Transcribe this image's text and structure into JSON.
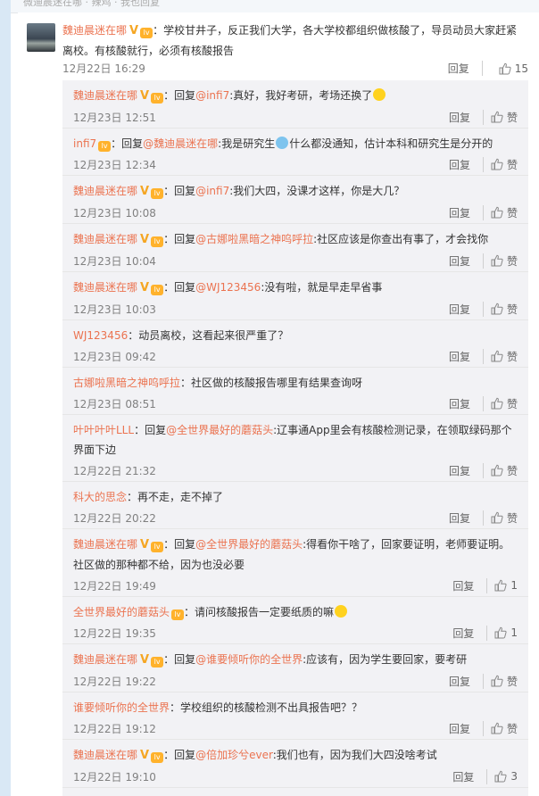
{
  "top": {
    "faint_text": "微迪晨迷在哪 · 辣鸡 · 我也回复"
  },
  "main": {
    "username": "魏迪晨迷在哪",
    "text": "：学校甘井子，反正我们大学，各大学校都组织做核酸了，导员动员大家赶紧离校。有核酸就行，必须有核酸报告",
    "time": "12月22日 16:29",
    "reply_label": "回复",
    "like_count": "15"
  },
  "replies": [
    {
      "user": "魏迪晨迷在哪",
      "v": true,
      "lvl": true,
      "prefix": "：回复",
      "target": "@infi7",
      "text": ":真好，我好考研，考场还换了",
      "emo": "yellow",
      "time": "12月23日 12:51",
      "reply_label": "回复",
      "like": "赞"
    },
    {
      "user": "infi7",
      "v": false,
      "lvl": true,
      "prefix": "：回复",
      "target": "@魏迪晨迷在哪",
      "text": ":我是研究生",
      "emo_mid": "blue",
      "text2": "什么都没通知，估计本科和研究生是分开的",
      "time": "12月23日 12:34",
      "reply_label": "回复",
      "like": "赞"
    },
    {
      "user": "魏迪晨迷在哪",
      "v": true,
      "lvl": true,
      "prefix": "：回复",
      "target": "@infi7",
      "text": ":我们大四，没课才这样，你是大几？",
      "time": "12月23日 10:08",
      "reply_label": "回复",
      "like": "赞"
    },
    {
      "user": "魏迪晨迷在哪",
      "v": true,
      "lvl": true,
      "prefix": "：回复",
      "target": "@古娜啦黑暗之神呜呼拉",
      "text": ":社区应该是你查出有事了，才会找你",
      "time": "12月23日 10:04",
      "reply_label": "回复",
      "like": "赞"
    },
    {
      "user": "魏迪晨迷在哪",
      "v": true,
      "lvl": true,
      "prefix": "：回复",
      "target": "@WJ123456",
      "text": ":没有啦，就是早走早省事",
      "time": "12月23日 10:03",
      "reply_label": "回复",
      "like": "赞"
    },
    {
      "user": "WJ123456",
      "v": false,
      "lvl": false,
      "prefix": "：",
      "target": "",
      "text": "动员离校，这看起来很严重了？",
      "time": "12月23日 09:42",
      "reply_label": "回复",
      "like": "赞"
    },
    {
      "user": "古娜啦黑暗之神呜呼拉",
      "v": false,
      "lvl": false,
      "prefix": "：",
      "target": "",
      "text": "社区做的核酸报告哪里有结果查询呀",
      "time": "12月23日 08:51",
      "reply_label": "回复",
      "like": "赞"
    },
    {
      "user": "叶叶叶叶LLL",
      "v": false,
      "lvl": false,
      "prefix": "：回复",
      "target": "@全世界最好的蘑菇头",
      "text": ":辽事通App里会有核酸检测记录，在领取绿码那个界面下边",
      "time": "12月22日 21:32",
      "reply_label": "回复",
      "like": "赞"
    },
    {
      "user": "科大的思念",
      "v": false,
      "lvl": false,
      "prefix": "：",
      "target": "",
      "text": "再不走，走不掉了",
      "time": "12月22日 20:22",
      "reply_label": "回复",
      "like": "赞"
    },
    {
      "user": "魏迪晨迷在哪",
      "v": true,
      "lvl": true,
      "prefix": "：回复",
      "target": "@全世界最好的蘑菇头",
      "text": ":得看你干啥了，回家要证明，老师要证明。社区做的那种都不给，因为也没必要",
      "time": "12月22日 19:49",
      "reply_label": "回复",
      "like": "1"
    },
    {
      "user": "全世界最好的蘑菇头",
      "v": false,
      "lvl": true,
      "prefix": "：",
      "target": "",
      "text": "请问核酸报告一定要纸质的嘛",
      "emo": "yellow",
      "time": "12月22日 19:35",
      "reply_label": "回复",
      "like": "1"
    },
    {
      "user": "魏迪晨迷在哪",
      "v": true,
      "lvl": true,
      "prefix": "：回复",
      "target": "@谁要倾听你的全世界",
      "text": ":应该有，因为学生要回家，要考研",
      "time": "12月22日 19:22",
      "reply_label": "回复",
      "like": "赞"
    },
    {
      "user": "谁要倾听你的全世界",
      "v": false,
      "lvl": false,
      "prefix": "：",
      "target": "",
      "text": "学校组织的核酸检测不出具报告吧？？",
      "time": "12月22日 19:12",
      "reply_label": "回复",
      "like": "赞"
    },
    {
      "user": "魏迪晨迷在哪",
      "v": true,
      "lvl": true,
      "prefix": "：回复",
      "target": "@倍加珍兮ever",
      "text": ":我们也有，因为我们大四没啥考试",
      "time": "12月22日 19:10",
      "reply_label": "回复",
      "like": "3"
    }
  ],
  "icons": {
    "thumb": "thumb-up-icon",
    "verified": "verified-v-icon",
    "level": "level-badge-icon",
    "emoji": "emoji-icon"
  },
  "colors": {
    "username": "#eb7350",
    "time": "#808080",
    "reply_bg": "#f2f2f5",
    "rail": "#d9e8f5"
  }
}
